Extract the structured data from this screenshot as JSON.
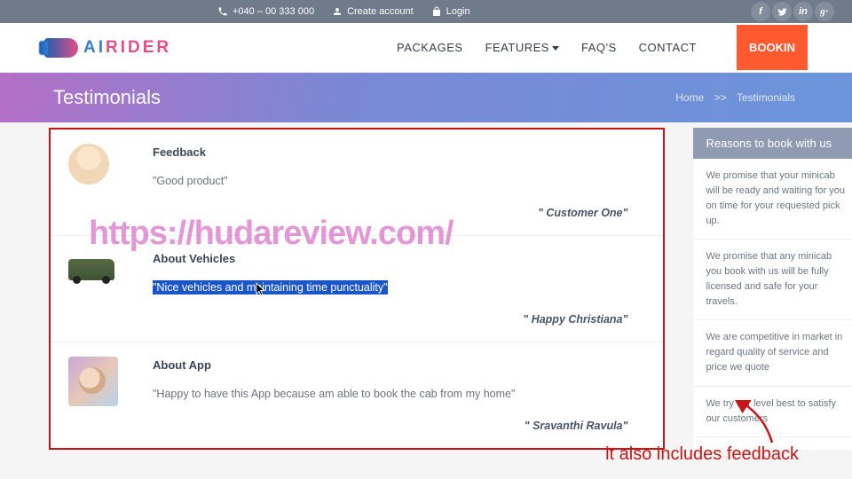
{
  "topbar": {
    "phone": "+040 – 00 333 000",
    "create": "Create account",
    "login": "Login",
    "social": [
      "f",
      "y",
      "in",
      "g"
    ]
  },
  "logo": {
    "ai": "AI",
    "rider": "RIDER"
  },
  "nav": {
    "packages": "PACKAGES",
    "features": "FEATURES",
    "faqs": "FAQ'S",
    "contact": "CONTACT",
    "book": "BOOKIN"
  },
  "page": {
    "title": "Testimonials",
    "crumb_home": "Home",
    "crumb_sep": ">>",
    "crumb_current": "Testimonials"
  },
  "testimonials": [
    {
      "title": "Feedback",
      "text": "\"Good product\"",
      "author": "\" Customer One\""
    },
    {
      "title": "About Vehicles",
      "text": "\"Nice vehicles and maintaining time punctuality\"",
      "author": "\" Happy Christiana\""
    },
    {
      "title": "About App",
      "text": "\"Happy to have this App because am able to book the cab from my home\"",
      "author": "\" Sravanthi Ravula\""
    }
  ],
  "sidebar": {
    "title": "Reasons to book with us",
    "items": [
      "We promise that your minicab will be ready and waiting for you on time for your requested pick up.",
      "We promise that any minicab you book with us will be fully licensed and safe for your travels.",
      "We are competitive in market in regard quality of service and price we quote",
      "We try our level best to satisfy our customers"
    ]
  },
  "watermark": "https://hudareview.com/",
  "annotation": "it also includes feedback"
}
